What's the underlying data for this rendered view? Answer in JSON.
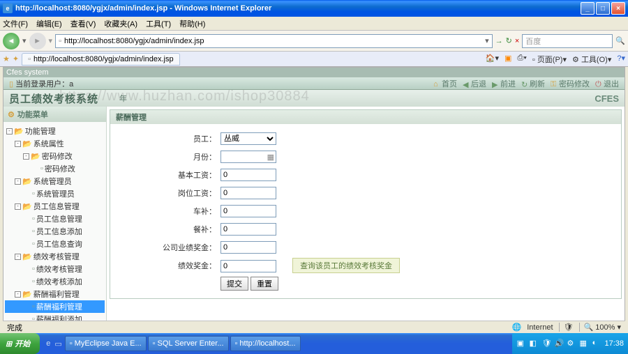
{
  "window": {
    "title": "http://localhost:8080/ygjx/admin/index.jsp - Windows Internet Explorer"
  },
  "menu": {
    "file": "文件(F)",
    "edit": "编辑(E)",
    "view": "查看(V)",
    "fav": "收藏夹(A)",
    "tools": "工具(T)",
    "help": "帮助(H)"
  },
  "address": {
    "url": "http://localhost:8080/ygjx/admin/index.jsp"
  },
  "search": {
    "placeholder": "百度"
  },
  "tab": {
    "title": "http://localhost:8080/ygjx/admin/index.jsp"
  },
  "toolbar_right": {
    "home": "",
    "print": "",
    "page": "页面(P)",
    "tools": "工具(O)"
  },
  "sys_title": "Cfes system",
  "header": {
    "login_label": "当前登录用户：",
    "login_user": "a",
    "links": {
      "home": "首页",
      "back": "后退",
      "forward": "前进",
      "refresh": "刷新",
      "pwd": "密码修改",
      "exit": "退出"
    }
  },
  "banner": {
    "sysname": "员工绩效考核系统",
    "date_prefix": "年",
    "cfes": "CFES"
  },
  "watermark": "https://www.huzhan.com/ishop30884",
  "sidebar": {
    "title": "功能菜单",
    "items": [
      {
        "d": 0,
        "t": "-",
        "i": "fold",
        "l": "功能管理"
      },
      {
        "d": 1,
        "t": "-",
        "i": "fold",
        "l": "系统属性"
      },
      {
        "d": 2,
        "t": "-",
        "i": "fold",
        "l": "密码修改"
      },
      {
        "d": 3,
        "t": "",
        "i": "doc",
        "l": "密码修改"
      },
      {
        "d": 1,
        "t": "-",
        "i": "fold",
        "l": "系统管理员"
      },
      {
        "d": 2,
        "t": "",
        "i": "doc",
        "l": "系统管理员"
      },
      {
        "d": 1,
        "t": "-",
        "i": "fold",
        "l": "员工信息管理"
      },
      {
        "d": 2,
        "t": "",
        "i": "doc",
        "l": "员工信息管理"
      },
      {
        "d": 2,
        "t": "",
        "i": "doc",
        "l": "员工信息添加"
      },
      {
        "d": 2,
        "t": "",
        "i": "doc",
        "l": "员工信息查询"
      },
      {
        "d": 1,
        "t": "-",
        "i": "fold",
        "l": "绩效考核管理"
      },
      {
        "d": 2,
        "t": "",
        "i": "doc",
        "l": "绩效考核管理"
      },
      {
        "d": 2,
        "t": "",
        "i": "doc",
        "l": "绩效考核添加"
      },
      {
        "d": 1,
        "t": "-",
        "i": "fold",
        "l": "薪酬福利管理"
      },
      {
        "d": 2,
        "t": "",
        "i": "doc",
        "l": "薪酬福利管理",
        "sel": true
      },
      {
        "d": 2,
        "t": "",
        "i": "doc",
        "l": "薪酬福利添加"
      }
    ]
  },
  "panel": {
    "title": "薪酬管理"
  },
  "form": {
    "emp_label": "员工：",
    "emp_selected": "丛威",
    "month_label": "月份：",
    "month_value": "",
    "base_label": "基本工资：",
    "base_value": "0",
    "post_label": "岗位工资：",
    "post_value": "0",
    "trans_label": "车补：",
    "trans_value": "0",
    "meal_label": "餐补：",
    "meal_value": "0",
    "perf_label": "公司业绩奖金：",
    "perf_value": "0",
    "bonus_label": "绩效奖金：",
    "bonus_value": "0",
    "hint": "查询该员工的绩效考核奖金",
    "submit": "提交",
    "reset": "重置"
  },
  "app_status": "员工绩效考核系统",
  "ie_status": {
    "done": "完成",
    "zone": "Internet",
    "zoom": "100%"
  },
  "taskbar": {
    "start": "开始",
    "tasks": [
      "MyEclipse Java E...",
      "SQL Server Enter...",
      "http://localhost..."
    ],
    "time": "17:38"
  }
}
